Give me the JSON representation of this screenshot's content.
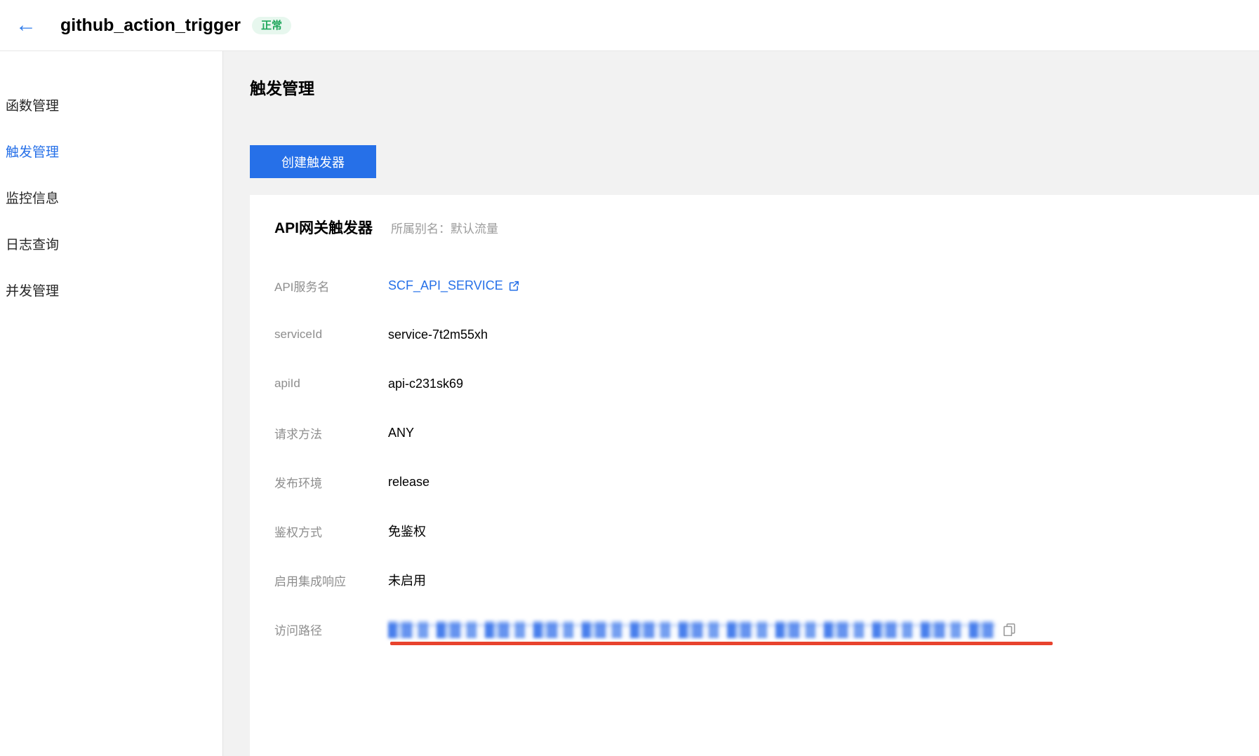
{
  "header": {
    "back_icon": "←",
    "title": "github_action_trigger",
    "status_badge": "正常"
  },
  "sidebar": {
    "items": [
      {
        "label": "函数管理",
        "active": false
      },
      {
        "label": "触发管理",
        "active": true
      },
      {
        "label": "监控信息",
        "active": false
      },
      {
        "label": "日志查询",
        "active": false
      },
      {
        "label": "并发管理",
        "active": false
      }
    ]
  },
  "main": {
    "page_title": "触发管理",
    "create_button": "创建触发器",
    "card": {
      "title": "API网关触发器",
      "subtitle": "所属别名：默认流量",
      "fields": [
        {
          "label": "API服务名",
          "value": "SCF_API_SERVICE",
          "type": "link"
        },
        {
          "label": "serviceId",
          "value": "service-7t2m55xh",
          "type": "text"
        },
        {
          "label": "apiId",
          "value": "api-c231sk69",
          "type": "text"
        },
        {
          "label": "请求方法",
          "value": "ANY",
          "type": "text"
        },
        {
          "label": "发布环境",
          "value": "release",
          "type": "text"
        },
        {
          "label": "鉴权方式",
          "value": "免鉴权",
          "type": "text"
        },
        {
          "label": "启用集成响应",
          "value": "未启用",
          "type": "text"
        },
        {
          "label": "访问路径",
          "value": "",
          "type": "redacted"
        }
      ]
    }
  },
  "icons": {
    "back": "back-arrow-icon",
    "external_link": "external-link-icon",
    "copy": "copy-icon"
  },
  "colors": {
    "accent_blue": "#2670e8",
    "badge_bg": "#e7f7ee",
    "badge_text": "#1fa75c",
    "annotation_red": "#e8432e",
    "panel_gray": "#f2f2f2",
    "label_gray": "#8e8e8e"
  }
}
